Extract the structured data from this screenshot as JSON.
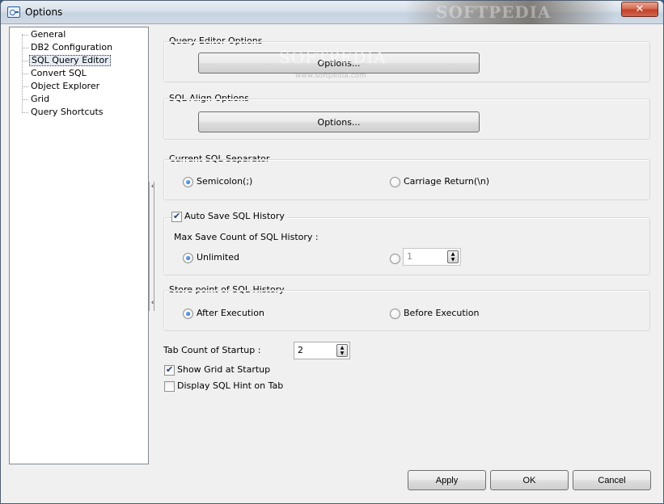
{
  "window": {
    "title": "Options",
    "close_label": "✕",
    "watermark": "SOFTPEDIA"
  },
  "tree": {
    "items": [
      {
        "label": "General",
        "selected": false
      },
      {
        "label": "DB2 Configuration",
        "selected": false
      },
      {
        "label": "SQL Query Editor",
        "selected": true
      },
      {
        "label": "Convert SQL",
        "selected": false
      },
      {
        "label": "Object Explorer",
        "selected": false
      },
      {
        "label": "Grid",
        "selected": false
      },
      {
        "label": "Query Shortcuts",
        "selected": false
      }
    ]
  },
  "splitter": {
    "arrow_top": "‹",
    "arrow_bottom": "‹"
  },
  "query_editor": {
    "label": "Query Editor Options",
    "button": "Options...",
    "watermark": "SOFTPEDIA",
    "watermark_sub": "www.softpedia.com"
  },
  "sql_align": {
    "label": "SQL Align Options",
    "button": "Options..."
  },
  "separator": {
    "label": "Current SQL Separator",
    "option1": "Semicolon(;)",
    "option2": "Carriage Return(\\n)",
    "selected": "option1"
  },
  "history": {
    "auto_save_label": "Auto Save SQL History",
    "auto_save_checked": true,
    "max_count_label": "Max Save Count of SQL History :",
    "unlimited_label": "Unlimited",
    "count_value": "1"
  },
  "store_point": {
    "label": "Store point of SQL History",
    "option1": "After Execution",
    "option2": "Before Execution"
  },
  "startup": {
    "tab_count_label": "Tab Count of Startup :",
    "tab_count_value": "2",
    "show_grid_label": "Show Grid at Startup",
    "show_grid_checked": true,
    "display_hint_label": "Display SQL Hint on Tab",
    "display_hint_checked": false
  },
  "footer": {
    "apply": "Apply",
    "ok": "OK",
    "cancel": "Cancel"
  }
}
